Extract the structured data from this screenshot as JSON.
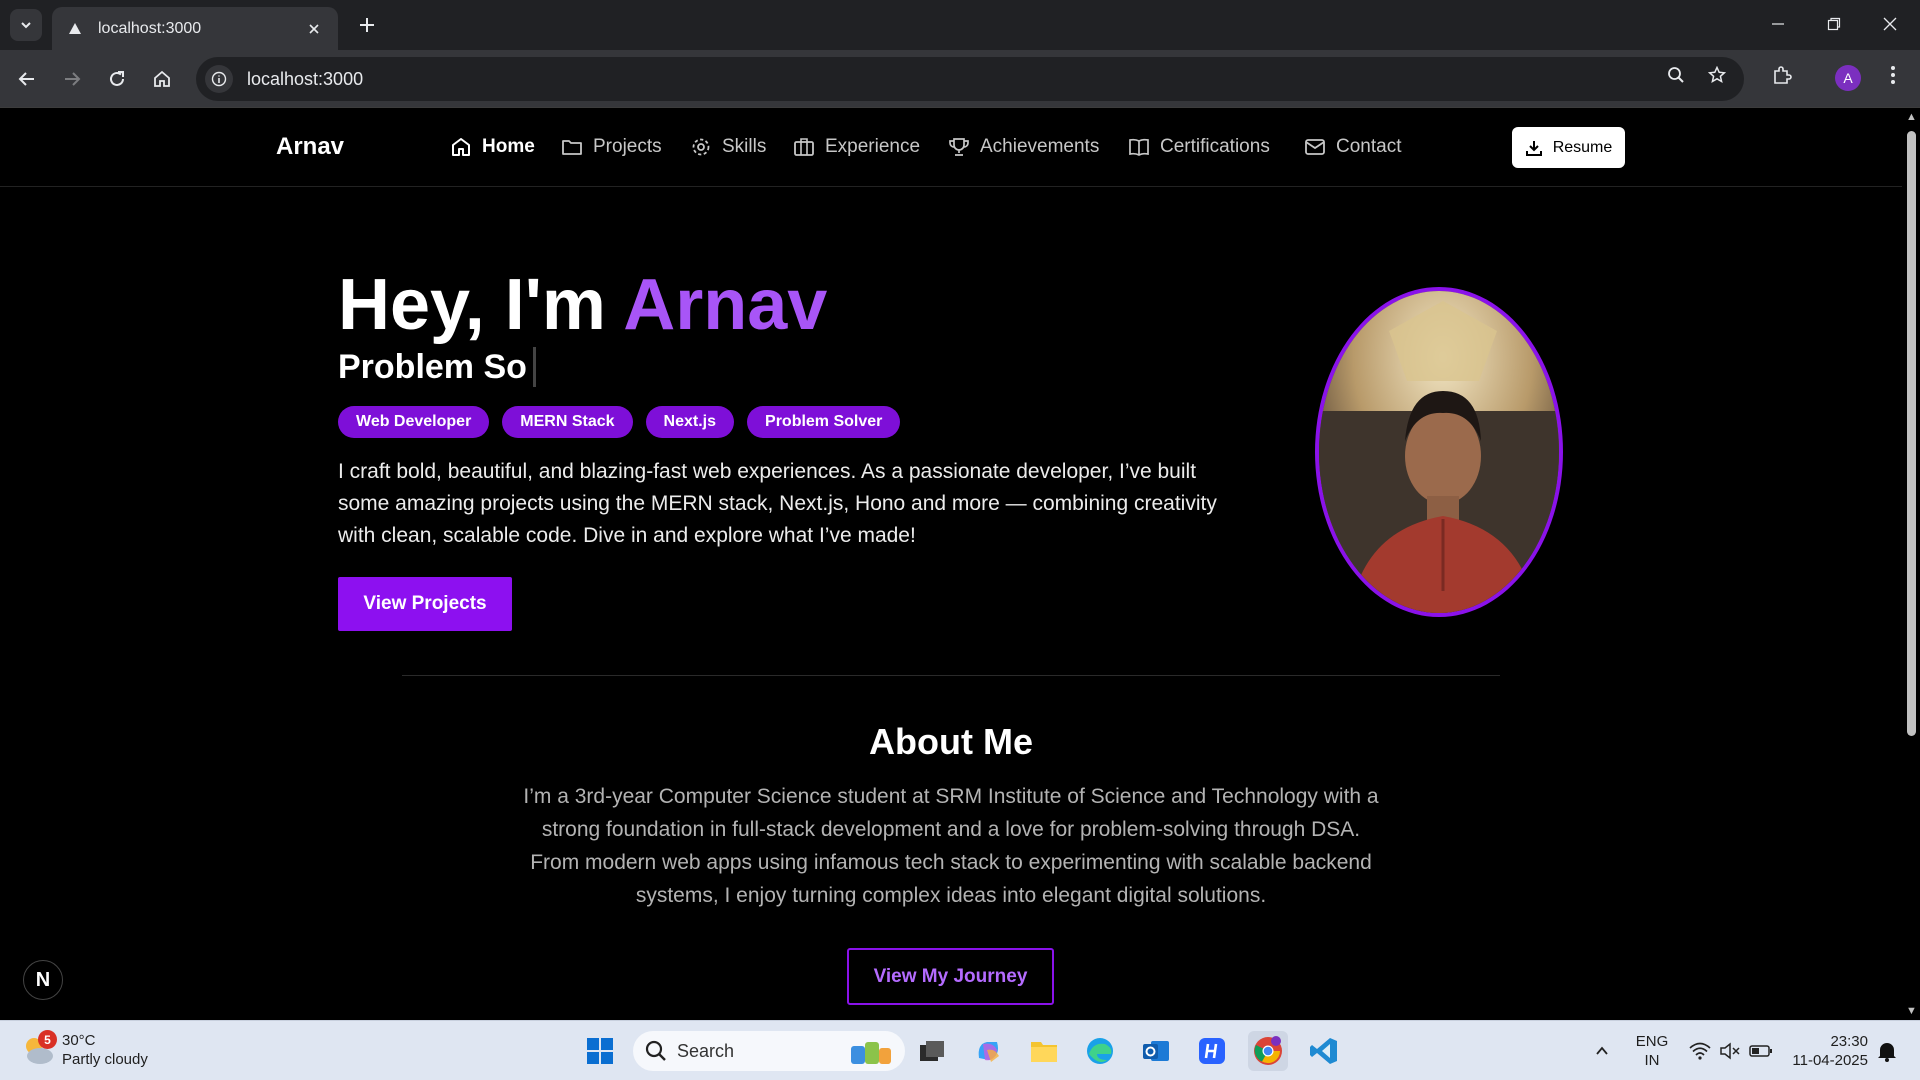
{
  "browser": {
    "tab_title": "localhost:3000",
    "url": "localhost:3000",
    "profile_initial": "A"
  },
  "site": {
    "brand": "Arnav",
    "nav": [
      {
        "label": "Home",
        "icon": "home-icon",
        "active": true
      },
      {
        "label": "Projects",
        "icon": "folder-icon"
      },
      {
        "label": "Skills",
        "icon": "gear-icon"
      },
      {
        "label": "Experience",
        "icon": "briefcase-icon"
      },
      {
        "label": "Achievements",
        "icon": "trophy-icon"
      },
      {
        "label": "Certifications",
        "icon": "book-icon"
      },
      {
        "label": "Contact",
        "icon": "mail-icon"
      }
    ],
    "resume_label": "Resume"
  },
  "hero": {
    "greeting": "Hey, I'm ",
    "name": "Arnav",
    "typing_text": "Problem So",
    "tags": [
      "Web Developer",
      "MERN Stack",
      "Next.js",
      "Problem Solver"
    ],
    "description": "I craft bold, beautiful, and blazing-fast web experiences. As a passionate developer, I’ve built some amazing projects using the MERN stack, Next.js, Hono and more — combining creativity with clean, scalable code. Dive in and explore what I’ve made!",
    "cta_label": "View Projects"
  },
  "about": {
    "title": "About Me",
    "text": "I’m a 3rd-year Computer Science student at SRM Institute of Science and Technology with a strong foundation in full-stack development and a love for problem-solving through DSA. From modern web apps using infamous tech stack to experimenting with scalable backend systems, I enjoy turning complex ideas into elegant digital solutions.",
    "cta_label": "View My Journey"
  },
  "dev_badge": "N",
  "taskbar": {
    "weather_temp": "30°C",
    "weather_desc": "Partly cloudy",
    "weather_badge": "5",
    "search_label": "Search",
    "lang": "ENG",
    "region": "IN",
    "time": "23:30",
    "date": "11-04-2025"
  },
  "colors": {
    "accent": "#a855f7",
    "button": "#8d10f0",
    "pill": "#7e0fd8"
  }
}
